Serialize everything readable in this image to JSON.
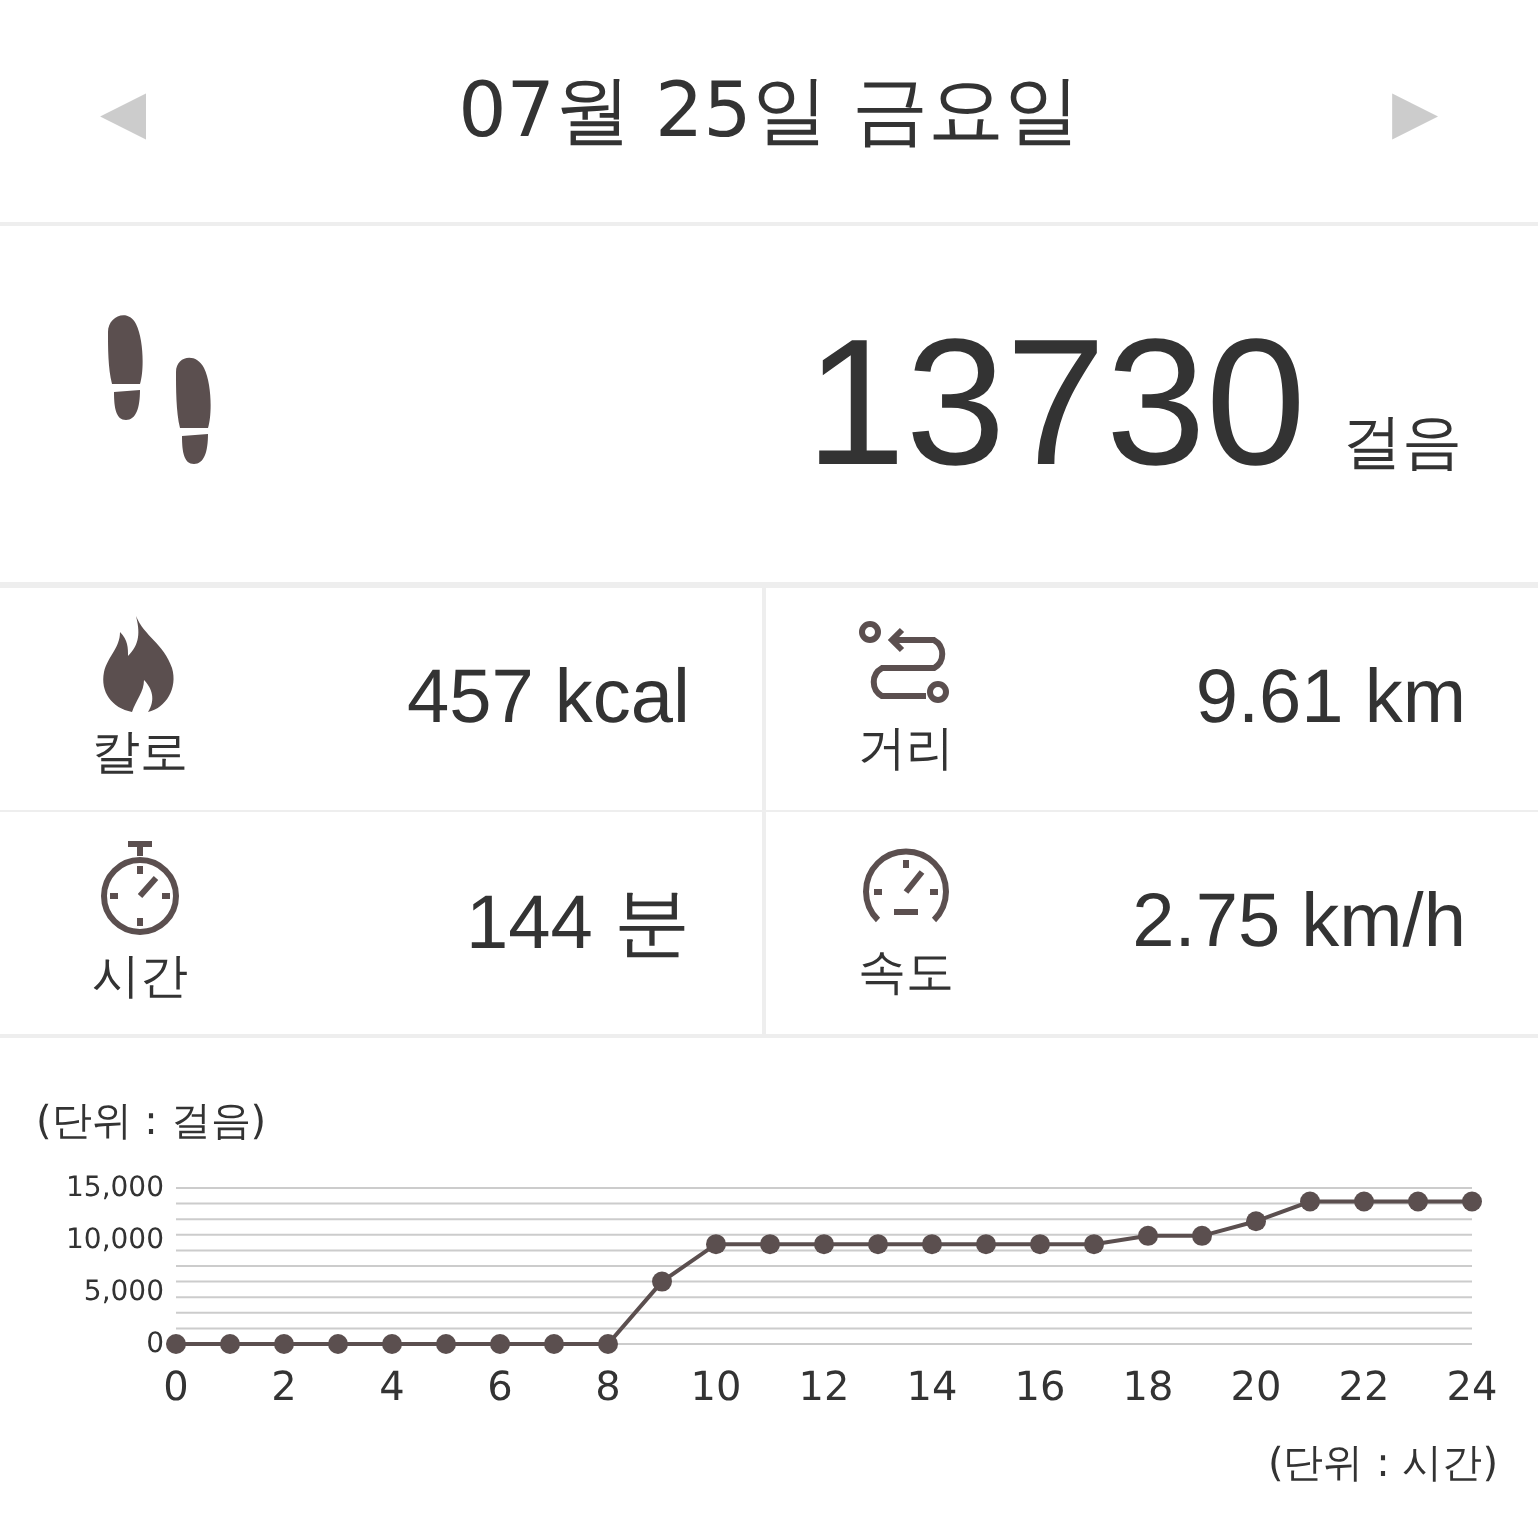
{
  "header": {
    "prev": "◀",
    "title": "07월 25일 금요일",
    "next": "▶"
  },
  "steps": {
    "value": "13730",
    "unit": "걸음"
  },
  "stats": [
    {
      "kind": "calorie",
      "label": "칼로",
      "value": "457 kcal"
    },
    {
      "kind": "distance",
      "label": "거리",
      "value": "9.61 km"
    },
    {
      "kind": "time",
      "label": "시간",
      "value": "144 분"
    },
    {
      "kind": "speed",
      "label": "속도",
      "value": "2.75 km/h"
    }
  ],
  "chart": {
    "unit_label": "(단위 : 걸음)",
    "chart_data": {
      "type": "line",
      "xlabel": "(단위 : 시간)",
      "x": [
        0,
        1,
        2,
        3,
        4,
        5,
        6,
        7,
        8,
        9,
        10,
        11,
        12,
        13,
        14,
        15,
        16,
        17,
        18,
        19,
        20,
        21,
        22,
        23,
        24
      ],
      "series": [
        {
          "color": "#5b4f4f",
          "marker": "circle",
          "values": [
            0,
            0,
            0,
            0,
            0,
            0,
            0,
            0,
            0,
            6000,
            9600,
            9600,
            9600,
            9600,
            9600,
            9600,
            9600,
            9600,
            10400,
            10400,
            11800,
            13700,
            13700,
            13700,
            13700
          ]
        }
      ],
      "xlim": [
        0,
        24
      ],
      "ylim": [
        0,
        15000
      ],
      "xticks": [
        0,
        2,
        4,
        6,
        8,
        10,
        12,
        14,
        16,
        18,
        20,
        22,
        24
      ],
      "yticks": [
        {
          "value": 0,
          "label": "0"
        },
        {
          "value": 5000,
          "label": "5,000"
        },
        {
          "value": 10000,
          "label": "10,000"
        },
        {
          "value": 15000,
          "label": "15,000"
        }
      ]
    }
  }
}
